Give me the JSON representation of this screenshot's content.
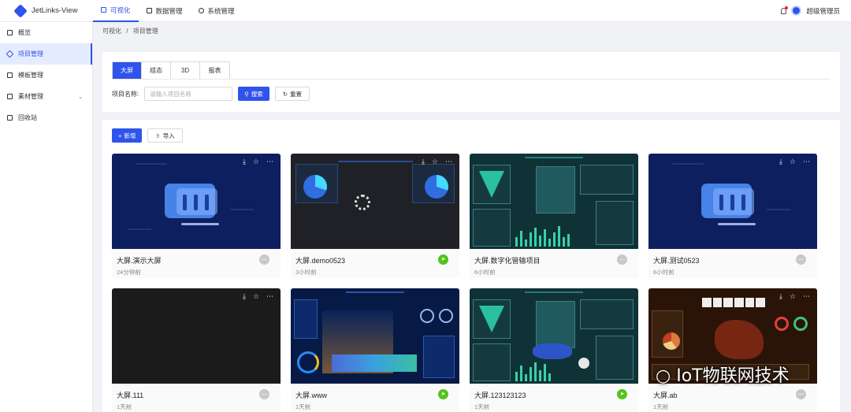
{
  "app": {
    "name": "JetLinks-View"
  },
  "topnav": [
    {
      "label": "可视化",
      "icon": "chart-icon",
      "active": true
    },
    {
      "label": "数据管理",
      "icon": "database-icon",
      "active": false
    },
    {
      "label": "系统管理",
      "icon": "settings-icon",
      "active": false
    }
  ],
  "user": {
    "name": "超级管理员"
  },
  "sidebar": [
    {
      "label": "概览",
      "icon": "dashboard-icon",
      "active": false
    },
    {
      "label": "项目管理",
      "icon": "project-icon",
      "active": true
    },
    {
      "label": "模板管理",
      "icon": "template-icon",
      "active": false
    },
    {
      "label": "素材管理",
      "icon": "material-icon",
      "active": false,
      "expandable": true
    },
    {
      "label": "回收站",
      "icon": "trash-icon",
      "active": false
    }
  ],
  "breadcrumb": {
    "root": "可视化",
    "sep": "/",
    "current": "项目管理"
  },
  "tabs": [
    {
      "label": "大屏",
      "active": true
    },
    {
      "label": "组态",
      "active": false
    },
    {
      "label": "3D",
      "active": false
    },
    {
      "label": "报表",
      "active": false
    }
  ],
  "search": {
    "label": "项目名称:",
    "placeholder": "请输入项目名称",
    "search_btn": "搜索",
    "reset_btn": "重置"
  },
  "toolbar": {
    "add_btn": "新增",
    "import_btn": "导入"
  },
  "cards": [
    {
      "title": "大屏.演示大屏",
      "time": "24分钟前",
      "published": false,
      "theme": "blue"
    },
    {
      "title": "大屏.demo0523",
      "time": "3小时前",
      "published": true,
      "theme": "dark"
    },
    {
      "title": "大屏.数字化管输项目",
      "time": "6小时前",
      "published": false,
      "theme": "teal"
    },
    {
      "title": "大屏.测试0523",
      "time": "6小时前",
      "published": false,
      "theme": "blue"
    },
    {
      "title": "大屏.111",
      "time": "1天前",
      "published": false,
      "theme": "black"
    },
    {
      "title": "大屏.www",
      "time": "1天前",
      "published": true,
      "theme": "city"
    },
    {
      "title": "大屏.123123123",
      "time": "1天前",
      "published": true,
      "theme": "teal"
    },
    {
      "title": "大屏.ab",
      "time": "1天前",
      "published": false,
      "theme": "brown"
    }
  ],
  "watermark": "IoT物联网技术",
  "colors": {
    "primary": "#2f54eb",
    "published": "#52c41a",
    "unpublished": "#c8c8c8"
  }
}
